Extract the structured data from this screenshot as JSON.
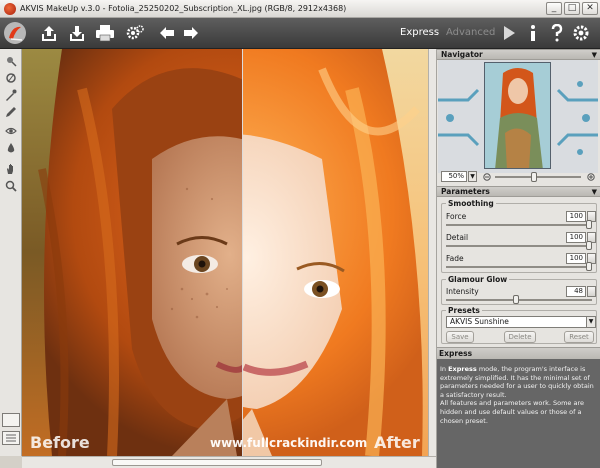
{
  "window": {
    "title": "AKVIS MakeUp v.3.0 - Fotolia_25250202_Subscription_XL.jpg (RGB/8, 2912x4368)",
    "min_glyph": "_",
    "max_glyph": "□",
    "close_glyph": "✕"
  },
  "toolbar": {
    "modes": {
      "express": "Express",
      "advanced": "Advanced"
    }
  },
  "canvas": {
    "before_label": "Before",
    "after_label": "After",
    "watermark": "www.fullcrackindir.com"
  },
  "navigator": {
    "title": "Navigator",
    "zoom_value": "50%"
  },
  "parameters": {
    "title": "Parameters",
    "smoothing": {
      "label": "Smoothing",
      "force": {
        "label": "Force",
        "value": "100",
        "level": 1.0
      },
      "detail": {
        "label": "Detail",
        "value": "100",
        "level": 1.0
      },
      "fade": {
        "label": "Fade",
        "value": "100",
        "level": 1.0
      }
    },
    "glamour": {
      "label": "Glamour Glow",
      "intensity": {
        "label": "Intensity",
        "value": "48",
        "level": 0.48
      }
    },
    "presets": {
      "label": "Presets",
      "selected": "AKVIS Sunshine",
      "save": "Save",
      "delete": "Delete",
      "reset": "Reset"
    }
  },
  "help": {
    "title": "Express",
    "p1_pre": "In ",
    "p1_bold": "Express",
    "p1_post": " mode, the program's interface is extremely simplified. It has the minimal set of parameters needed for a user to quickly obtain a satisfactory result.",
    "p2": "All features and parameters work. Some are hidden and use default values or those of a chosen preset."
  },
  "colors": {
    "toolbar_bg": "#4a4a4a",
    "panel_bg": "#e6e4e0",
    "help_bg": "#666666"
  }
}
